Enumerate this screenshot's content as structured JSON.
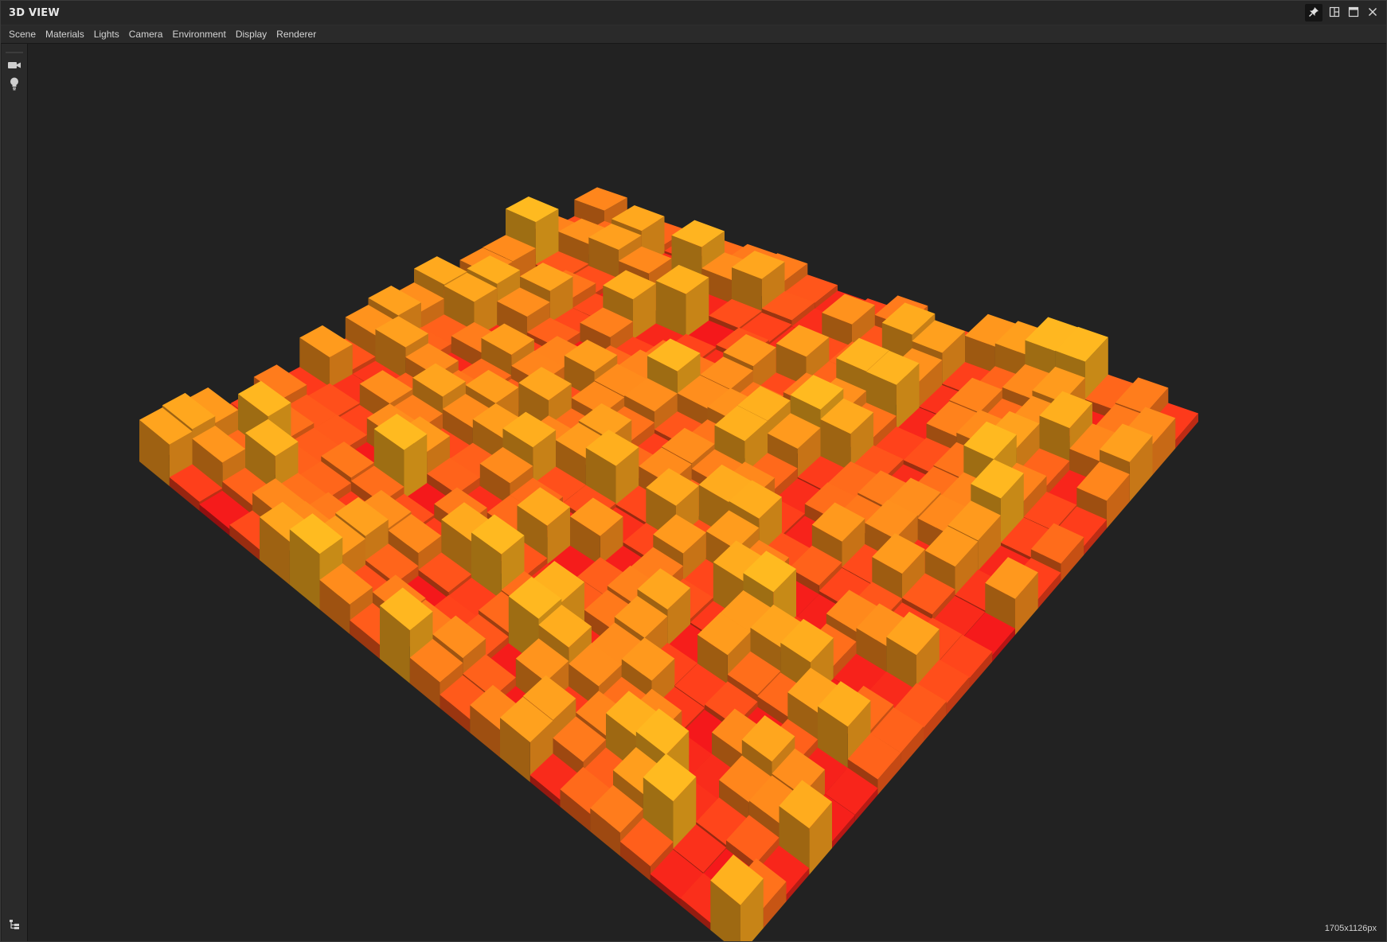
{
  "window": {
    "title": "3D VIEW",
    "buttons": [
      {
        "name": "pin-icon"
      },
      {
        "name": "layout-icon"
      },
      {
        "name": "maximize-icon"
      },
      {
        "name": "close-icon"
      }
    ]
  },
  "menu": {
    "items": [
      "Scene",
      "Materials",
      "Lights",
      "Camera",
      "Environment",
      "Display",
      "Renderer"
    ]
  },
  "toolstrip": {
    "icons": [
      "camera-icon",
      "light-bulb-icon",
      "scene-tree-icon"
    ]
  },
  "viewport": {
    "resolution_label": "1705x1126px",
    "background": "#222222",
    "scene": {
      "type": "3d-bar-heightmap",
      "grid": [
        20,
        20
      ],
      "colors": {
        "low": "#e8161a",
        "mid": "#ff6a1a",
        "high": "#ffb21e"
      }
    }
  }
}
